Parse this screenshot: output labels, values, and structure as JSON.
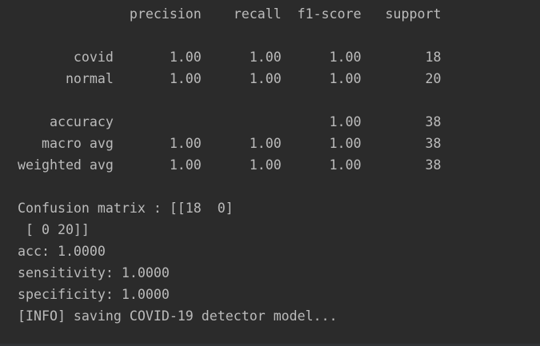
{
  "console": {
    "report": {
      "header": "              precision    recall  f1-score   support",
      "rows": [
        "       covid       1.00      1.00      1.00        18",
        "      normal       1.00      1.00      1.00        20"
      ],
      "summary": [
        "    accuracy                           1.00        38",
        "   macro avg       1.00      1.00      1.00        38",
        "weighted avg       1.00      1.00      1.00        38"
      ]
    },
    "confusion_matrix": [
      "Confusion matrix : [[18  0]",
      " [ 0 20]]"
    ],
    "metrics": [
      "acc: 1.0000",
      "sensitivity: 1.0000",
      "specificity: 1.0000"
    ],
    "info": "[INFO] saving COVID-19 detector model..."
  }
}
